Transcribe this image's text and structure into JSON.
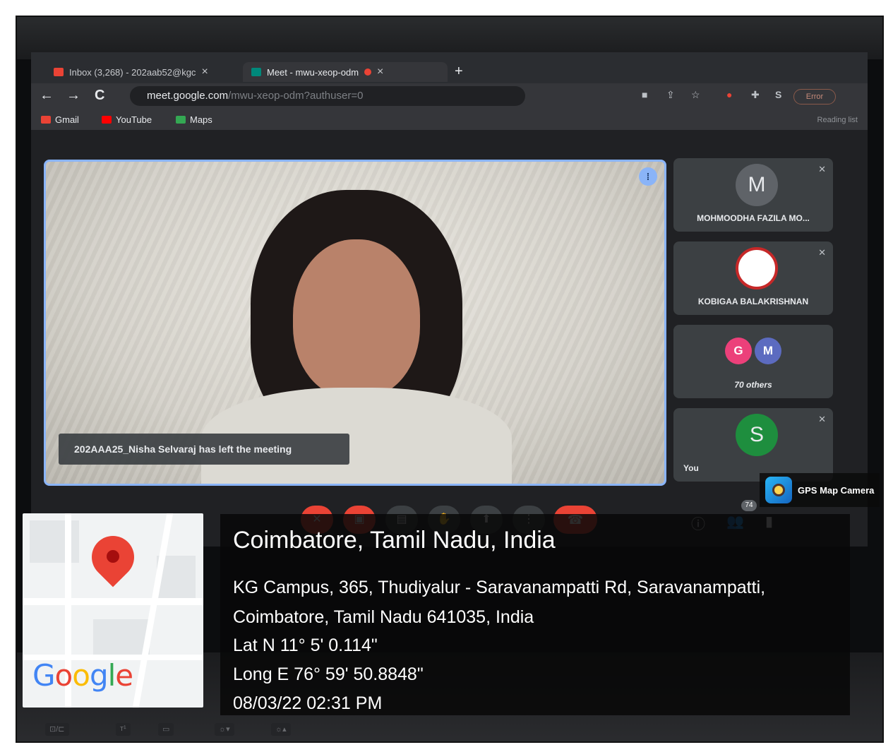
{
  "browser": {
    "tabs": [
      {
        "label": "Inbox (3,268) - 202aab52@kgc",
        "close": "×"
      },
      {
        "label": "Meet - mwu-xeop-odm",
        "close": "×"
      }
    ],
    "new_tab": "+",
    "nav": {
      "back": "←",
      "forward": "→",
      "reload": "C"
    },
    "url": {
      "domain": "meet.google.com",
      "path": "/mwu-xeop-odm?authuser=0"
    },
    "error_label": "Error",
    "profile_initial": "S",
    "bookmarks": [
      {
        "label": "Gmail",
        "color": "#ea4335"
      },
      {
        "label": "YouTube",
        "color": "#ff0000"
      },
      {
        "label": "Maps",
        "color": "#34a853"
      }
    ],
    "reading_list": "Reading list"
  },
  "meet": {
    "main_toast": "202AAA25_Nisha Selvaraj has left the meeting",
    "participants": [
      {
        "name": "MOHMOODHA FAZILA MO...",
        "initial": "M",
        "color": "#5f6368"
      },
      {
        "name": "KOBIGAA BALAKRISHNAN",
        "initial": "",
        "color": "#ffffff"
      },
      {
        "name": "70 others",
        "initial": "",
        "color": "#3c4043",
        "chips": [
          "G",
          "M"
        ]
      },
      {
        "name": "You",
        "initial": "S",
        "color": "#1e8e3e"
      }
    ],
    "meeting_code": "mwu-xeop-odm",
    "participant_count": "74",
    "controls": [
      "mic-off",
      "camera-off",
      "captions",
      "raise-hand",
      "present",
      "more",
      "leave-call"
    ]
  },
  "gps": {
    "app_label": "GPS Map Camera",
    "city": "Coimbatore, Tamil Nadu, India",
    "address_line1": "KG Campus, 365, Thudiyalur - Saravanampatti Rd, Saravanampatti,",
    "address_line2": "Coimbatore, Tamil Nadu 641035, India",
    "lat": "Lat N 11° 5' 0.114\"",
    "long": "Long E 76° 59' 50.8848\"",
    "datetime": "08/03/22 02:31 PM",
    "map_brand": "Google"
  }
}
